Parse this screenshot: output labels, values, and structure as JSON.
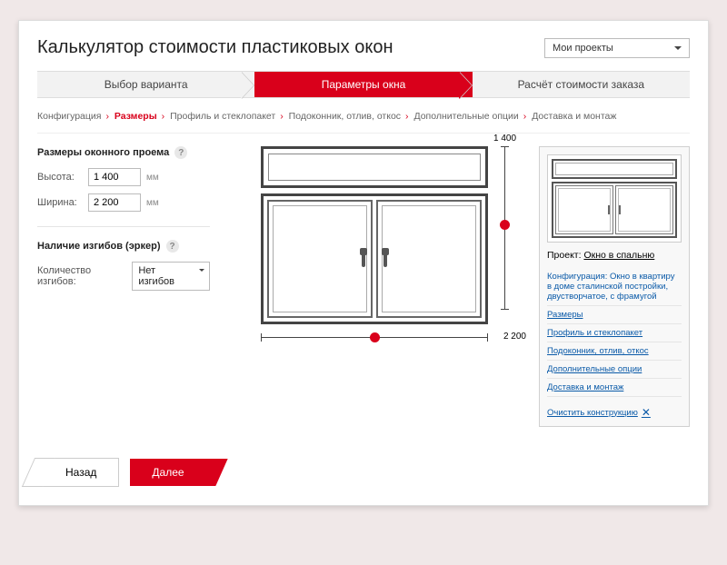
{
  "header": {
    "title": "Калькулятор стоимости пластиковых окон",
    "projects_label": "Мои проекты"
  },
  "steps": [
    "Выбор варианта",
    "Параметры окна",
    "Расчёт стоимости заказа"
  ],
  "crumbs": [
    "Конфигурация",
    "Размеры",
    "Профиль и стеклопакет",
    "Подоконник, отлив, откос",
    "Дополнительные опции",
    "Доставка и монтаж"
  ],
  "active_crumb_index": 1,
  "form": {
    "section1_title": "Размеры оконного проема",
    "height_label": "Высота:",
    "height_value": "1 400",
    "width_label": "Ширина:",
    "width_value": "2 200",
    "unit": "мм",
    "section2_title": "Наличие изгибов (эркер)",
    "bends_label": "Количество изгибов:",
    "bends_value": "Нет изгибов"
  },
  "dims": {
    "h_label": "1 400",
    "w_label": "2 200"
  },
  "side": {
    "project_prefix": "Проект:",
    "project_name": "Окно в спальню",
    "config_label": "Конфигурация:",
    "config_desc": "Окно в квартиру в доме сталинской постройки, двустворчатое, с фрамугой",
    "links": [
      "Размеры",
      "Профиль и стеклопакет",
      "Подоконник, отлив, откос",
      "Дополнительные опции",
      "Доставка и монтаж"
    ],
    "clear": "Очистить конструкцию"
  },
  "nav": {
    "back": "Назад",
    "next": "Далее"
  }
}
